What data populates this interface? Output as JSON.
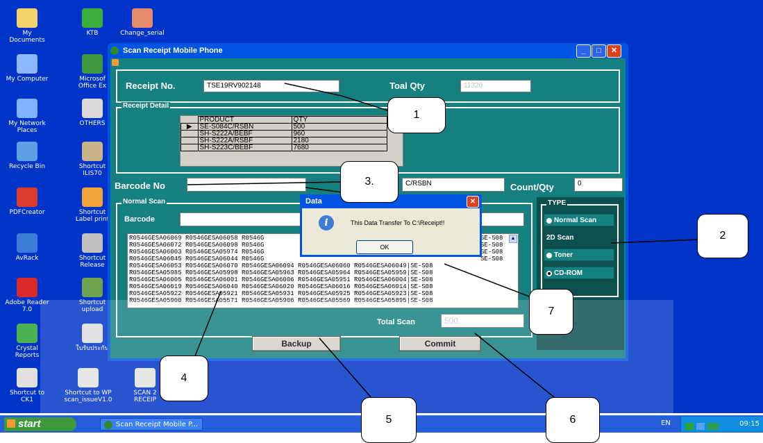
{
  "desktop_icons": [
    {
      "id": "my-documents",
      "label": "My Documents",
      "x": "",
      "icon": "folder-icon",
      "color": "#f3d36b"
    },
    {
      "id": "ktb",
      "label": "KTB",
      "icon": "app-icon",
      "color": "#3cae3c"
    },
    {
      "id": "change-serial",
      "label": "Change_serial",
      "icon": "app-icon",
      "color": "#e58a6a"
    },
    {
      "id": "my-computer",
      "label": "My Computer",
      "icon": "computer-icon",
      "color": "#8fb7ff"
    },
    {
      "id": "microsoft-excel",
      "label": "Microsof\nOffice Ex",
      "icon": "excel-icon",
      "color": "#3f9a3f"
    },
    {
      "id": "my-network",
      "label": "My Network\nPlaces",
      "icon": "network-icon",
      "color": "#7fb3ff"
    },
    {
      "id": "others",
      "label": "OTHERS",
      "icon": "folder-icon",
      "color": "#d9d9d9"
    },
    {
      "id": "recycle-bin",
      "label": "Recycle Bin",
      "icon": "recycle-bin-icon",
      "color": "#5da0e3"
    },
    {
      "id": "shortcut-ilis",
      "label": "Shortcut\nILIS70",
      "icon": "shortcut-icon",
      "color": "#c7b48b"
    },
    {
      "id": "pdfcreator",
      "label": "PDFCreator",
      "icon": "pdf-icon",
      "color": "#d83a2d"
    },
    {
      "id": "shortcut-label",
      "label": "Shortcut\nLabel print",
      "icon": "shortcut-icon",
      "color": "#f2a33a"
    },
    {
      "id": "avrack",
      "label": "AvRack",
      "icon": "app-icon",
      "color": "#3a7cd8"
    },
    {
      "id": "shortcut-release",
      "label": "Shortcut\nRelease",
      "icon": "shortcut-icon",
      "color": "#c0c0c0"
    },
    {
      "id": "adobe-reader",
      "label": "Adobe Reader\n7.0",
      "icon": "adobe-icon",
      "color": "#d82a2a"
    },
    {
      "id": "shortcut-upload",
      "label": "Shortcut\nupload",
      "icon": "shortcut-icon",
      "color": "#6ca34f"
    },
    {
      "id": "crystal-reports",
      "label": "Crystal\nReports",
      "icon": "app-icon",
      "color": "#4caf50"
    },
    {
      "id": "thai-receipt",
      "label": "ใบรับประกัน",
      "icon": "document-icon",
      "color": "#dcdcdc"
    },
    {
      "id": "shortcut-wp",
      "label": "Shortcut to\nCK1",
      "icon": "shortcut-icon",
      "color": "#e0e0e0"
    },
    {
      "id": "shortcut-scan",
      "label": "Shortcut to WP\nscan_issueV1.0",
      "icon": "shortcut-icon",
      "color": "#e0e0e0"
    },
    {
      "id": "scan-receipt",
      "label": "SCAN 2\nRECEIP",
      "icon": "shortcut-icon",
      "color": "#e0e0e0"
    }
  ],
  "window": {
    "title": "Scan Receipt Mobile Phone",
    "receipt_label": "Receipt No.",
    "receipt_no": "TSE19RV902148",
    "total_qty_label": "Toal Qty",
    "total_qty": "11320",
    "receipt_detail_title": "Receipt Detail",
    "table_headers": [
      "PRODUCT",
      "QTY"
    ],
    "table_rows": [
      [
        "SE-S084C/RSBN",
        "500"
      ],
      [
        "SH-S222A/BEBF",
        "960"
      ],
      [
        "SH-S222A/RSBF",
        "2180"
      ],
      [
        "SH-S223C/BEBF",
        "7680"
      ]
    ],
    "barcode_no_label": "Barcode No",
    "barcode_no_value": "",
    "product_field": "C/RSBN",
    "count_label": "Count/Qty",
    "count_value": "0",
    "normal_scan_title": "Normal Scan",
    "barcode_label": "Barcode",
    "scan_lines": [
      "R0546GESA06069 R0546GESA06058 R0546G",
      "R0546GESA06072 R0546GESA06098 R0546G",
      "R0546GESA06003 R0546GESA05974 R0546G",
      "R0546GESA06045 R0546GESA06044 R0546G",
      "R0546GESA06053 R0546GESA06070 R0546GESA06094 R0546GESA06060 R0546GESA06049|SE-S08",
      "R0546GESA05985 R0546GESA05998 R0546GESA05963 R0546GESA05964 R0546GESA05959|SE-S08",
      "R0546GESA06005 R0546GESA06001 R0546GESA06006 R0546GESA05951 R0546GESA06004|SE-S08",
      "R0546GESA06019 R0546GESA06040 R0546GESA06020 R0546GESA06016 R0546GESA06014|SE-S08",
      "R0546GESA05922 R0546GESA05921 R0546GESA05931 R0546GESA05925 R0546GESA05923|SE-S08",
      "R0546GESA05900 R0546GESA05571 R0546GESA05906 R0546GESA05569 R0546GESA05895|SE-S08"
    ],
    "scan_tails": [
      "SE-S08",
      "SE-S08",
      "SE-S08",
      "SE-S08"
    ],
    "total_scan_label": "Total Scan",
    "total_scan": "500",
    "type_title": "TYPE",
    "type_options": [
      "Normal Scan",
      "2D Scan",
      "Toner",
      "CD-ROM"
    ],
    "backup_label": "Backup",
    "commit_label": "Commit"
  },
  "dialog": {
    "title": "Data",
    "message": "This Data Transfer To C:\\Receipt!!",
    "ok_label": "OK"
  },
  "taskbar": {
    "start_label": "start",
    "task_label": "Scan Receipt Mobile P...",
    "lang": "EN",
    "clock": "09:15"
  },
  "callouts": [
    "1",
    "2",
    "3.",
    "4",
    "5",
    "6",
    "7"
  ]
}
